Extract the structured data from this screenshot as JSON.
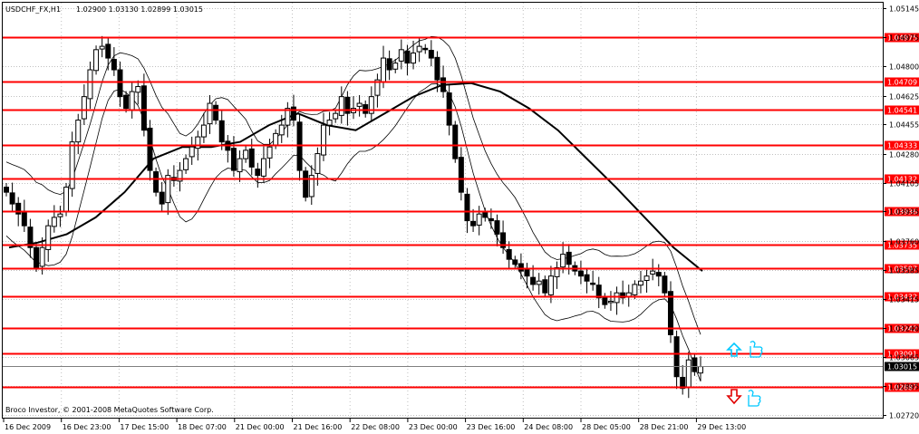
{
  "header": {
    "symbol_label": "USDCHF_FX,H1",
    "ohlc_label": "1.02900 1.03130 1.02899 1.03015"
  },
  "copyright": "Broco Investor, © 2001-2008 MetaQuotes Software Corp.",
  "colors": {
    "background": "#ffffff",
    "frame": "#000000",
    "level_line": "#ff0000",
    "level_box": "#ff0000",
    "level_text": "#ffffff",
    "current_box": "#000000",
    "candle": "#000000",
    "grid": "#c0c0c0",
    "up_signal": "#00c8ff",
    "down_signal": "#e00000",
    "thumb_icon": "#00c8ff"
  },
  "signals": {
    "up_arrow_icon": "up-arrow-icon",
    "down_arrow_icon": "down-arrow-icon",
    "thumb_icon": "thumbs-up-icon"
  },
  "chart_data": {
    "type": "candlestick",
    "symbol": "USDCHF_FX",
    "timeframe": "H1",
    "ylim": [
      1.027,
      1.0518
    ],
    "y_ticks": [
      "1.05145",
      "1.04975",
      "1.04800",
      "1.04625",
      "1.04455",
      "1.04280",
      "1.04105",
      "1.03935",
      "1.03760",
      "1.03585",
      "1.03415",
      "1.03240",
      "1.03065",
      "1.02895",
      "1.02720"
    ],
    "x_ticks": [
      "16 Dec 2009",
      "16 Dec 23:00",
      "17 Dec 15:00",
      "18 Dec 07:00",
      "21 Dec 00:00",
      "21 Dec 16:00",
      "22 Dec 08:00",
      "23 Dec 00:00",
      "23 Dec 16:00",
      "24 Dec 08:00",
      "28 Dec 05:00",
      "28 Dec 21:00",
      "29 Dec 13:00"
    ],
    "grid": true,
    "horizontal_levels": [
      "1.04975",
      "1.04709",
      "1.04541",
      "1.04333",
      "1.04132",
      "1.03936",
      "1.03735",
      "1.03597",
      "1.03432",
      "1.03242",
      "1.03091",
      "1.02887"
    ],
    "current_price": "1.03015",
    "close_path": [
      1.0405,
      1.0398,
      1.0392,
      1.0385,
      1.0372,
      1.036,
      1.0372,
      1.0385,
      1.039,
      1.0392,
      1.0408,
      1.0435,
      1.0448,
      1.0462,
      1.0478,
      1.049,
      1.0492,
      1.0485,
      1.0478,
      1.0462,
      1.0455,
      1.0465,
      1.0468,
      1.0442,
      1.0418,
      1.0405,
      1.0398,
      1.0415,
      1.0412,
      1.0418,
      1.0425,
      1.0432,
      1.0438,
      1.0445,
      1.0458,
      1.0448,
      1.0435,
      1.043,
      1.0418,
      1.0425,
      1.043,
      1.042,
      1.0415,
      1.0425,
      1.0432,
      1.044,
      1.0445,
      1.0455,
      1.0448,
      1.0418,
      1.0402,
      1.0415,
      1.0428,
      1.0445,
      1.0448,
      1.0452,
      1.0462,
      1.0452,
      1.0455,
      1.0458,
      1.0452,
      1.0462,
      1.0472,
      1.0485,
      1.0478,
      1.0482,
      1.049,
      1.0482,
      1.0488,
      1.0492,
      1.049,
      1.0485,
      1.0472,
      1.0465,
      1.0445,
      1.0425,
      1.0405,
      1.0388,
      1.0385,
      1.0392,
      1.039,
      1.0388,
      1.038,
      1.0372,
      1.0365,
      1.0362,
      1.0358,
      1.0355,
      1.035,
      1.0352,
      1.0345,
      1.0355,
      1.036,
      1.0368,
      1.0362,
      1.0358,
      1.0355,
      1.0352,
      1.035,
      1.0342,
      1.0338,
      1.034,
      1.0345,
      1.0342,
      1.0345,
      1.035,
      1.0352,
      1.0355,
      1.0358,
      1.0355,
      1.0345,
      1.032,
      1.0295,
      1.0288,
      1.0305,
      1.0298,
      1.0301
    ],
    "moving_average": [
      1.0372,
      1.0375,
      1.038,
      1.039,
      1.0405,
      1.0425,
      1.0432,
      1.0432,
      1.0435,
      1.0445,
      1.0452,
      1.0445,
      1.0442,
      1.0452,
      1.0462,
      1.0469,
      1.047,
      1.0465,
      1.0455,
      1.0442,
      1.0425,
      1.0408,
      1.039,
      1.0372,
      1.0358
    ]
  }
}
